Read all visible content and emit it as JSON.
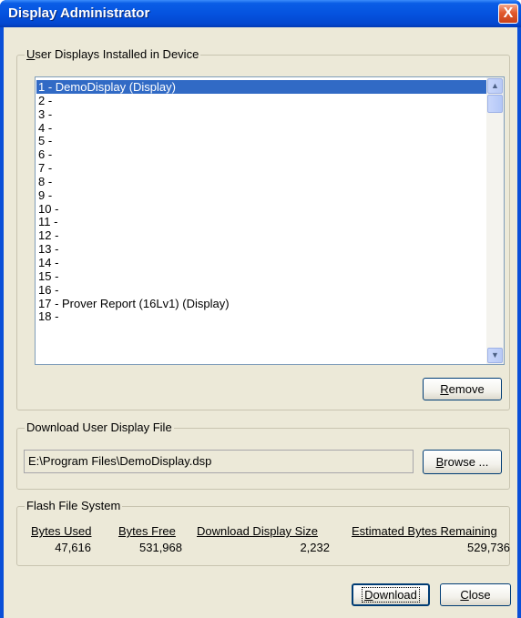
{
  "window": {
    "title": "Display Administrator",
    "close_glyph": "X"
  },
  "displays_group": {
    "label_accel": "U",
    "label_rest": "ser Displays Installed in Device",
    "items": [
      "1 - DemoDisplay  (Display)",
      "2 -",
      "3 -",
      "4 -",
      "5 -",
      "6 -",
      "7 -",
      "8 -",
      "9 -",
      "10 -",
      "11 -",
      "12 -",
      "13 -",
      "14 -",
      "15 -",
      "16 -",
      "17 - Prover Report (16Lv1)  (Display)",
      "18 -"
    ],
    "selected_index": 0,
    "remove_accel": "R",
    "remove_rest": "emove"
  },
  "download_group": {
    "label": "Download User Display File",
    "path": "E:\\Program Files\\DemoDisplay.dsp",
    "browse_accel": "B",
    "browse_rest": "rowse ..."
  },
  "flash_group": {
    "label": "Flash File System",
    "columns": [
      {
        "header": "Bytes Used",
        "value": "47,616"
      },
      {
        "header": "Bytes Free",
        "value": "531,968"
      },
      {
        "header": "Download Display Size",
        "value": "2,232"
      },
      {
        "header": "Estimated Bytes Remaining",
        "value": "529,736"
      }
    ]
  },
  "footer": {
    "download_accel": "D",
    "download_rest": "ownload",
    "close_accel": "C",
    "close_rest": "lose"
  },
  "colors": {
    "titlebar": "#0553df",
    "selection": "#316ac5",
    "dialog_bg": "#ece9d8"
  },
  "icons": {
    "close": "close-icon",
    "scroll_up": "scroll-up-arrow-icon",
    "scroll_down": "scroll-down-arrow-icon"
  }
}
